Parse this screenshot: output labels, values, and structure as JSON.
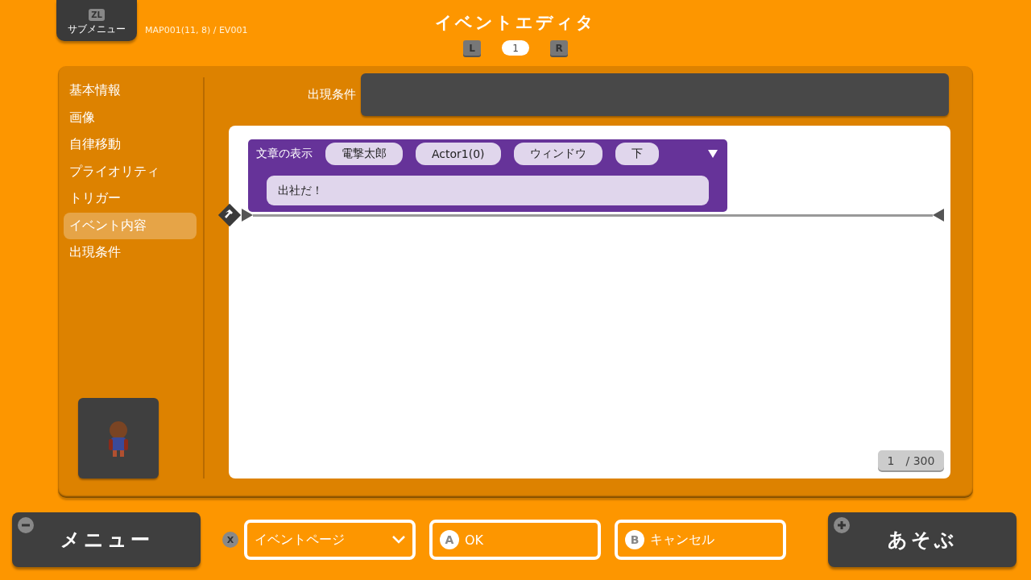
{
  "header": {
    "submenu": {
      "key": "ZL",
      "label": "サブメニュー"
    },
    "location": "MAP001(11, 8) / EV001",
    "title": "イベントエディタ",
    "pager": {
      "prev_key": "L",
      "page": "1",
      "next_key": "R"
    }
  },
  "sidebar": {
    "items": [
      {
        "label": "基本情報",
        "selected": false
      },
      {
        "label": "画像",
        "selected": false
      },
      {
        "label": "自律移動",
        "selected": false
      },
      {
        "label": "プライオリティ",
        "selected": false
      },
      {
        "label": "トリガー",
        "selected": false
      },
      {
        "label": "イベント内容",
        "selected": true
      },
      {
        "label": "出現条件",
        "selected": false
      }
    ]
  },
  "condition": {
    "label": "出現条件"
  },
  "commands": [
    {
      "kind": "message",
      "name": "文章の表示",
      "params": [
        "電撃太郎",
        "Actor1(0)",
        "ウィンドウ",
        "下"
      ],
      "text": "出社だ！"
    }
  ],
  "counter": {
    "current": "1",
    "total": "/ 300"
  },
  "footer": {
    "menu_button": "メニュー",
    "page_select": {
      "key": "X",
      "label": "イベントページ"
    },
    "ok": {
      "key": "A",
      "label": "OK"
    },
    "cancel": {
      "key": "B",
      "label": "キャンセル"
    },
    "play_button": "あそぶ"
  }
}
